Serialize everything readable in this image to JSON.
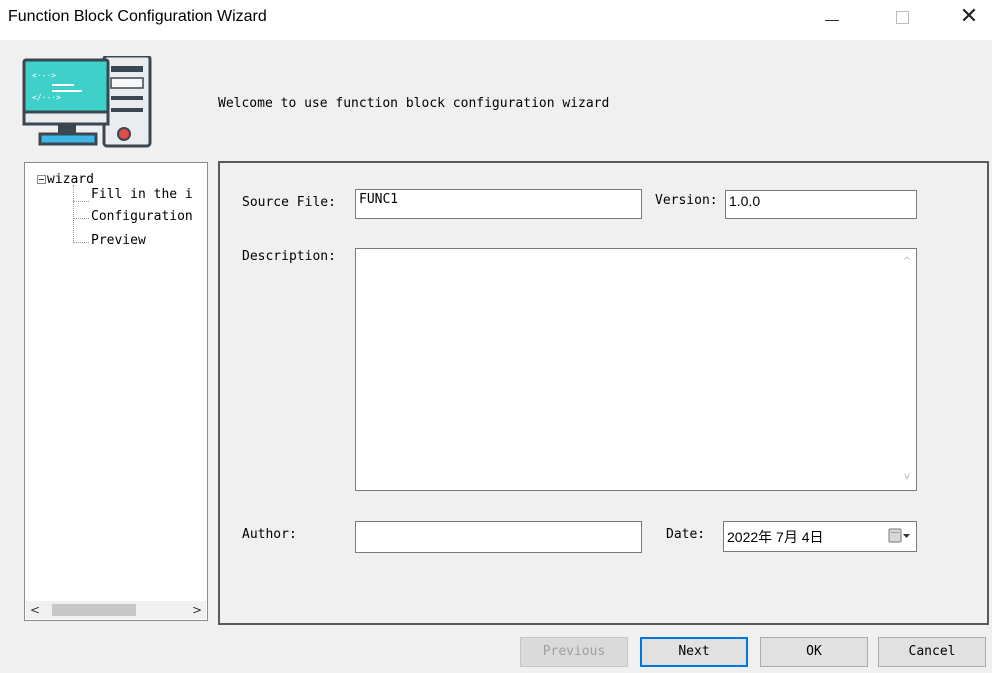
{
  "window": {
    "title": "Function Block Configuration Wizard",
    "minimize_icon": "minimize-icon",
    "maximize_icon": "maximize-icon",
    "close_icon": "close-icon",
    "close_glyph": "✕"
  },
  "header": {
    "icon": "computer-code-icon",
    "welcome_text": "Welcome to use function block configuration wizard"
  },
  "tree": {
    "root_label": "wizard",
    "items": [
      {
        "label": "Fill in the i"
      },
      {
        "label": "Configuration"
      },
      {
        "label": "Preview"
      }
    ],
    "scroll_left": "<",
    "scroll_right": ">"
  },
  "form": {
    "source_file_label": "Source File:",
    "source_file_value": "FUNC1",
    "version_label": "Version:",
    "version_value": "1.0.0",
    "description_label": "Description:",
    "description_value": "",
    "author_label": "Author:",
    "author_value": "",
    "date_label": "Date:",
    "date_value": "2022年 7月 4日",
    "scroll_up": "^",
    "scroll_down": "v"
  },
  "buttons": {
    "previous": "Previous",
    "next": "Next",
    "ok": "OK",
    "cancel": "Cancel"
  },
  "colors": {
    "accent": "#0078d7",
    "window_bg": "#f0f0f0",
    "panel_border": "#5a5a5a"
  }
}
